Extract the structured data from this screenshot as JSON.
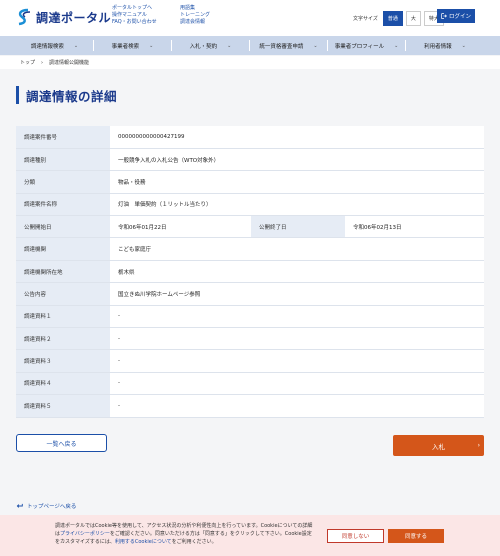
{
  "header": {
    "logo_text": "調達ポータル",
    "links_col1": [
      "ポータルトップへ",
      "操作マニュアル",
      "FAQ・お問い合わせ"
    ],
    "links_col2": [
      "用語集",
      "トレーニング",
      "調達会情報"
    ],
    "font_size_label": "文字サイズ",
    "font_sizes": [
      "普通",
      "大",
      "特大"
    ],
    "login_label": "ログイン"
  },
  "nav": {
    "items": [
      "調達情報検索",
      "事業者検索",
      "入札・契約",
      "統一資格審査申請",
      "事業者プロフィール",
      "利用者情報"
    ]
  },
  "breadcrumb": {
    "home": "トップ",
    "separator": "›",
    "current": "調達情報公開機能"
  },
  "page_title": "調達情報の詳細",
  "details": {
    "case_number_label": "調達案件番号",
    "case_number_value": "0000000000000427199",
    "type_label": "調達種別",
    "type_value": "一般競争入札の入札公告（WTO対象外）",
    "category_label": "分類",
    "category_value": "物品・役務",
    "name_label": "調達案件名称",
    "name_value": "灯油　単価契約（１リットル当たり）",
    "start_label": "公開開始日",
    "start_value": "令和06年01月22日",
    "end_label": "公開終了日",
    "end_value": "令和06年02月13日",
    "agency_label": "調達機関",
    "agency_value": "こども家庭庁",
    "location_label": "調達機関所在地",
    "location_value": "栃木県",
    "notice_label": "公告内容",
    "notice_value": "国立きぬ川学院ホームページ参照",
    "docs": [
      {
        "label": "調達資料１",
        "value": "-"
      },
      {
        "label": "調達資料２",
        "value": "-"
      },
      {
        "label": "調達資料３",
        "value": "-"
      },
      {
        "label": "調達資料４",
        "value": "-"
      },
      {
        "label": "調達資料５",
        "value": "-"
      }
    ]
  },
  "buttons": {
    "back_list": "一覧へ戻る",
    "bid": "入札",
    "top_link": "トップページへ戻る"
  },
  "cookie": {
    "text_1": "調達ポータルではCookie等を使用して、アクセス状況の分析や利便性向上を行っています。Cookieについての詳細は",
    "privacy_link": "プライバシーポリシー",
    "text_2": "をご確認ください。同意いただける方は「同意する」をクリックして下さい。Cookie設定をカスタマイズするには、",
    "cookie_link": "利用するCookieについて",
    "text_3": "をご利用ください。",
    "decline_label": "同意しない",
    "agree_label": "同意する"
  }
}
